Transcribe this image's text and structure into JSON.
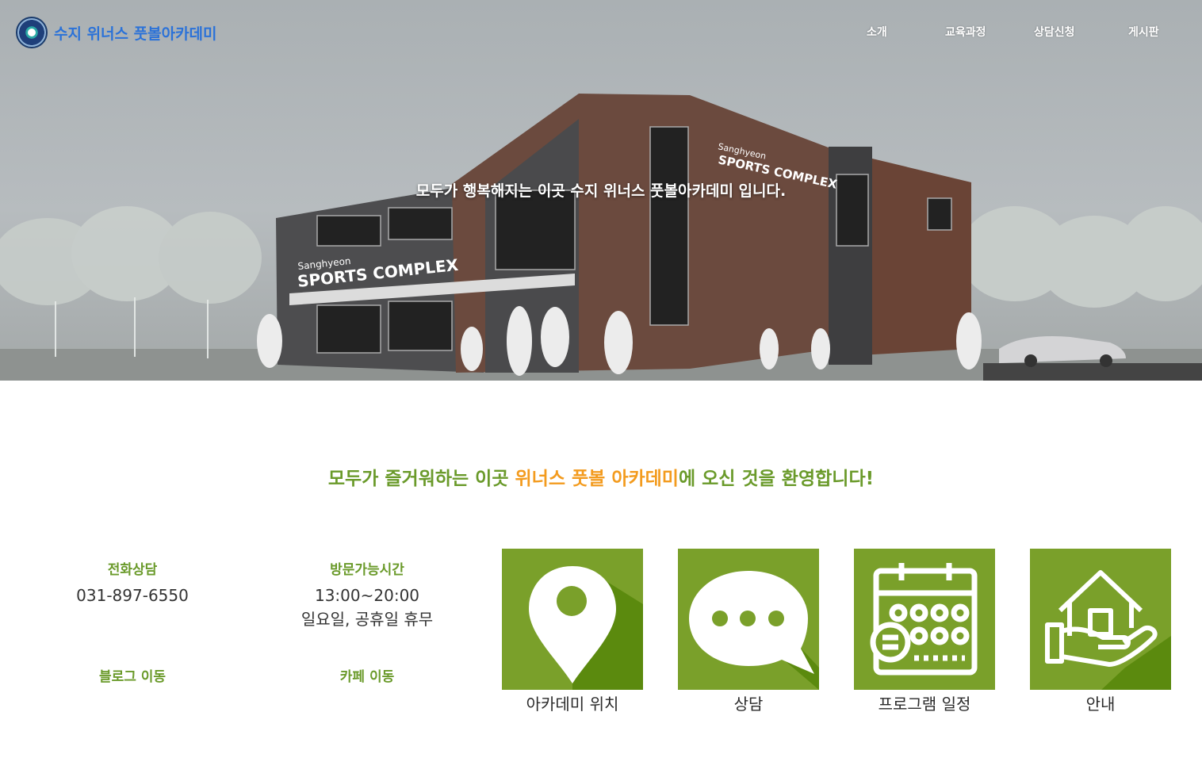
{
  "header": {
    "brand": "수지 위너스 풋볼아카데미",
    "nav": [
      "소개",
      "교육과정",
      "상담신청",
      "게시판"
    ]
  },
  "hero": {
    "title": "모두가 행복해지는 이곳 수지 위너스 풋볼아카데미 입니다.",
    "building_sign_small": "Sanghyeon",
    "building_sign_large": "SPORTS COMPLEX"
  },
  "welcome": {
    "before": "모두가 즐거워하는 이곳 ",
    "highlight": "위너스 풋볼 아카데미",
    "after": "에 오신 것을 환영합니다!"
  },
  "info": {
    "phone_label": "전화상담",
    "phone_value": "031-897-6550",
    "hours_label": "방문가능시간",
    "hours_value": "13:00~20:00",
    "hours_note": "일요일, 공휴일 휴무",
    "blog_label": "블로그 이동",
    "cafe_label": "카페 이동"
  },
  "tiles": [
    {
      "label": "아카데미 위치",
      "icon": "location-pin-icon"
    },
    {
      "label": "상담",
      "icon": "chat-bubble-icon"
    },
    {
      "label": "프로그램 일정",
      "icon": "calendar-icon"
    },
    {
      "label": "안내",
      "icon": "house-hand-icon"
    }
  ],
  "colors": {
    "accent_green": "#7aa02a",
    "text_green": "#6a9a2a",
    "highlight_orange": "#f39b1e",
    "brand_blue": "#2b72d8"
  }
}
